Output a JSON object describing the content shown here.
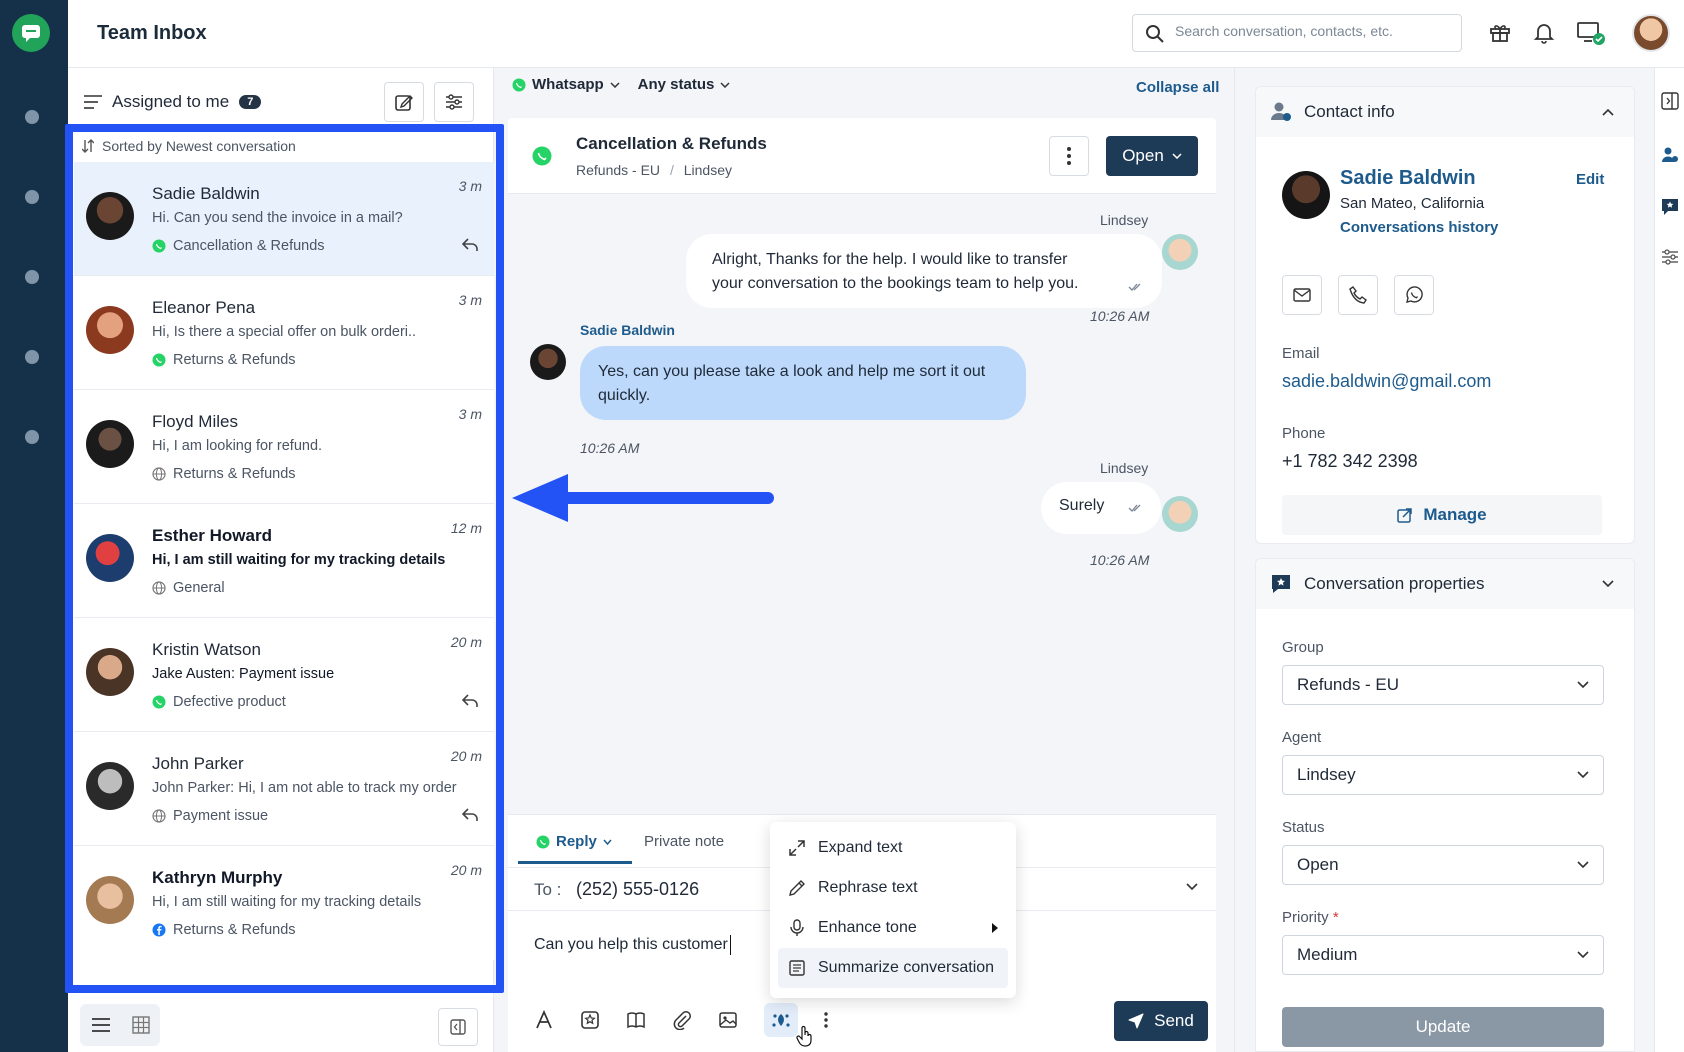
{
  "app": {
    "title": "Team Inbox"
  },
  "search": {
    "placeholder": "Search conversation, contacts, etc."
  },
  "colors": {
    "accent": "#1e5b8d",
    "highlight": "#2453f5",
    "whatsapp": "#25d366",
    "rail": "#153049"
  },
  "list": {
    "filter_label": "Assigned to me",
    "count": "7",
    "sort_label": "Sorted by Newest conversation",
    "conversations": [
      {
        "name": "Sadie Baldwin",
        "message": "Hi. Can you send the invoice in a mail?",
        "tag": "Cancellation & Refunds",
        "time": "3 m",
        "channel": "whatsapp-icon"
      },
      {
        "name": "Eleanor Pena",
        "message": "Hi, Is there a special offer on bulk orderi..",
        "tag": "Returns & Refunds",
        "time": "3 m",
        "channel": "whatsapp-icon"
      },
      {
        "name": "Floyd Miles",
        "message": "Hi, I am looking for refund.",
        "tag": "Returns & Refunds",
        "time": "3 m",
        "channel": "globe-icon"
      },
      {
        "name": "Esther Howard",
        "message": "Hi, I am still waiting for my tracking details",
        "tag": "General",
        "time": "12 m",
        "channel": "globe-icon"
      },
      {
        "name": "Kristin Watson",
        "message": "Jake Austen: Payment issue",
        "tag": "Defective product",
        "time": "20 m",
        "channel": "whatsapp-icon"
      },
      {
        "name": "John Parker",
        "message": "John Parker: Hi, I am not able to track my order",
        "tag": "Payment issue",
        "time": "20 m",
        "channel": "globe-icon"
      },
      {
        "name": "Kathryn Murphy",
        "message": "Hi, I am still waiting for my tracking details",
        "tag": "Returns & Refunds",
        "time": "20 m",
        "channel": "facebook-icon"
      }
    ]
  },
  "filters": {
    "channel": "Whatsapp",
    "status": "Any status",
    "collapse": "Collapse all"
  },
  "chat": {
    "title": "Cancellation & Refunds",
    "crumb_group": "Refunds - EU",
    "crumb_sep": "/",
    "crumb_agent": "Lindsey",
    "status_button": "Open",
    "messages": [
      {
        "sender": "Lindsey",
        "text_line1": "Alright, Thanks for the help. I would like to transfer",
        "text_line2": "your conversation to the bookings team to help you.",
        "time": "10:26 AM"
      },
      {
        "sender": "Sadie Baldwin",
        "text_line1": "Yes, can you please take a look and help me sort it out",
        "text_line2": "quickly.",
        "time": "10:26 AM"
      },
      {
        "sender": "Lindsey",
        "text_line1": "Surely",
        "time": "10:26 AM"
      }
    ]
  },
  "composer": {
    "tab_reply": "Reply",
    "tab_note": "Private note",
    "to_label": "To :",
    "to_value": "(252) 555-0126",
    "text": "Can you help this customer",
    "send": "Send",
    "ai_menu": [
      "Expand text",
      "Rephrase text",
      "Enhance tone",
      "Summarize conversation"
    ]
  },
  "contact": {
    "section_title": "Contact info",
    "name": "Sadie Baldwin",
    "edit": "Edit",
    "location": "San Mateo, California",
    "history": "Conversations history",
    "email_label": "Email",
    "email": "sadie.baldwin@gmail.com",
    "phone_label": "Phone",
    "phone": "+1 782 342 2398",
    "manage": "Manage"
  },
  "properties": {
    "section_title": "Conversation properties",
    "group_label": "Group",
    "group_value": "Refunds - EU",
    "agent_label": "Agent",
    "agent_value": "Lindsey",
    "status_label": "Status",
    "status_value": "Open",
    "priority_label": "Priority",
    "priority_required": "*",
    "priority_value": "Medium",
    "update": "Update"
  }
}
